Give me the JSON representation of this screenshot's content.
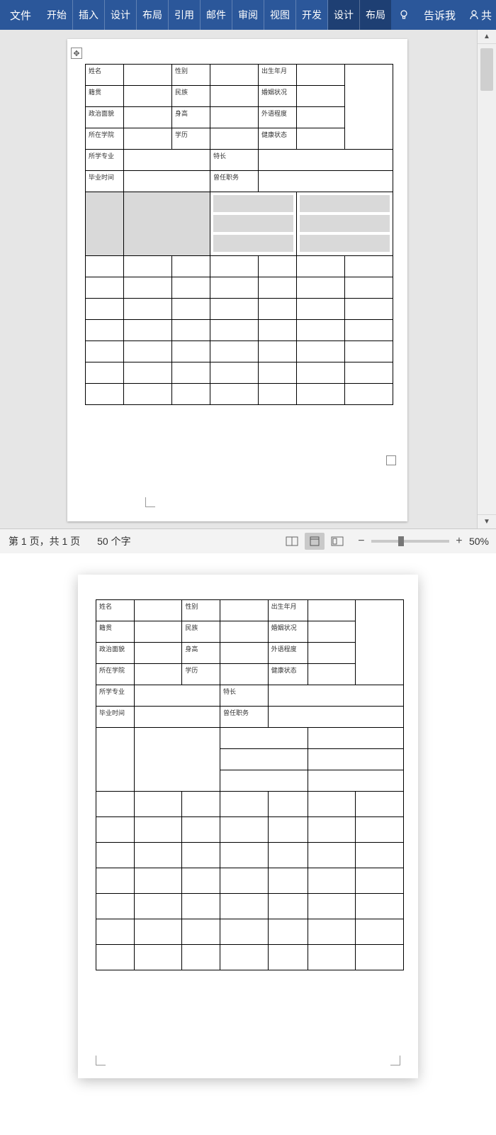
{
  "ribbon": {
    "file": "文件",
    "tabs": [
      "开始",
      "插入",
      "设计",
      "布局",
      "引用",
      "邮件",
      "审阅",
      "视图",
      "开发"
    ],
    "context_tabs": [
      "设计",
      "布局"
    ],
    "tell_me": "告诉我",
    "share": "共"
  },
  "form": {
    "name": "姓名",
    "gender": "性别",
    "birth": "出生年月",
    "origin": "籍贯",
    "nation": "民族",
    "marriage": "婚姻状况",
    "politics": "政治面貌",
    "height": "身高",
    "foreign": "外语程度",
    "college": "所在学院",
    "degree": "学历",
    "health": "健康状态",
    "major": "所学专业",
    "specialty": "特长",
    "grad": "毕业时间",
    "duty": "曾任职务"
  },
  "status": {
    "page": "第 1 页，共 1 页",
    "words": "50 个字",
    "zoom": "50%"
  }
}
